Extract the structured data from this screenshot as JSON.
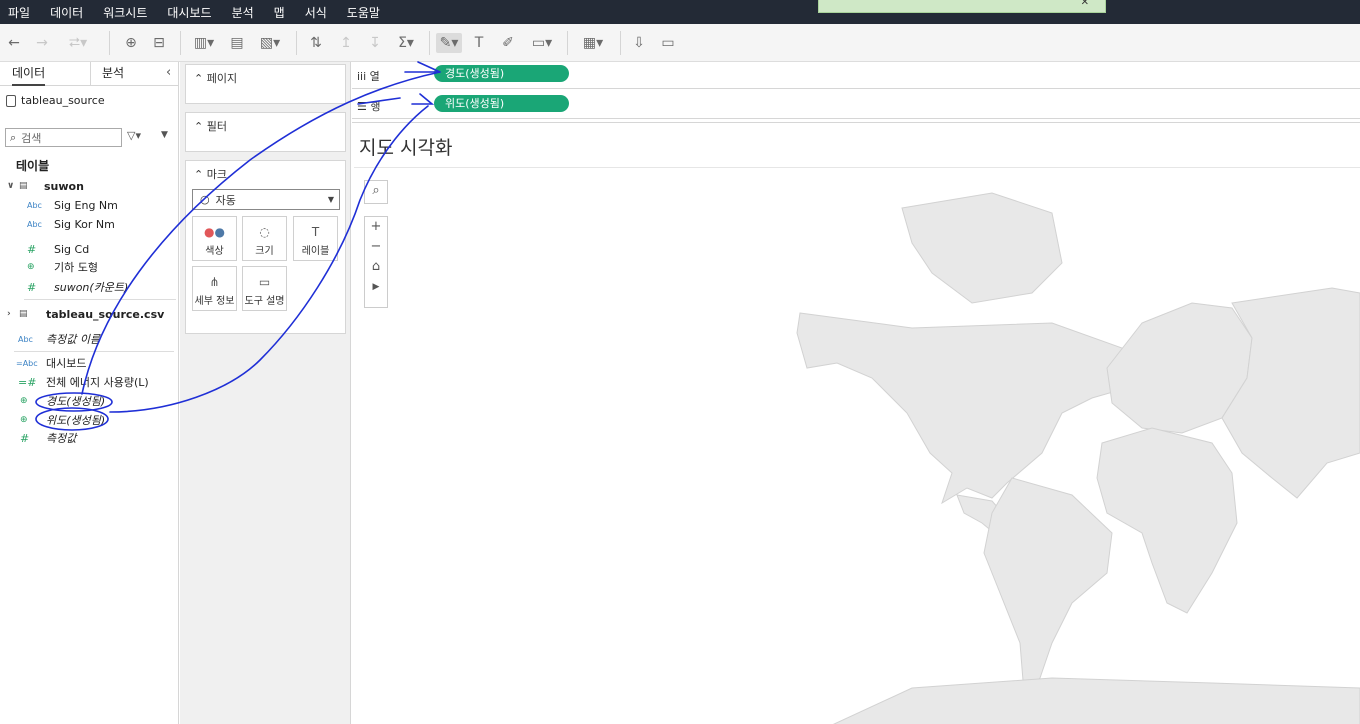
{
  "menu": [
    "파일",
    "데이터",
    "워크시트",
    "대시보드",
    "분석",
    "맵",
    "서식",
    "도움말"
  ],
  "data_pane": {
    "tab_data": "데이터",
    "tab_analysis": "분석",
    "datasource": "tableau_source",
    "search_placeholder": "검색",
    "section_tables": "테이블",
    "table1": {
      "name": "suwon",
      "fields": [
        {
          "type": "Abc",
          "name": "Sig Eng Nm"
        },
        {
          "type": "Abc",
          "name": "Sig Kor Nm"
        },
        {
          "type": "#",
          "name": "Sig Cd"
        },
        {
          "type": "globe",
          "name": "기하 도형"
        },
        {
          "type": "#",
          "name": "suwon(카운트)"
        }
      ]
    },
    "table2": {
      "name": "tableau_source.csv"
    },
    "extra_fields": [
      {
        "type": "Abc",
        "name": "측정값 이름"
      },
      {
        "type": "=Abc",
        "name": "대시보드"
      },
      {
        "type": "=#",
        "name": "전체 에너지 사용량(L)"
      },
      {
        "type": "globe",
        "name": "경도(생성됨)"
      },
      {
        "type": "globe",
        "name": "위도(생성됨)"
      },
      {
        "type": "#",
        "name": "측정값"
      }
    ]
  },
  "cards": {
    "pages": "페이지",
    "filters": "필터",
    "marks": "마크",
    "mark_type": "자동",
    "buttons": [
      "색상",
      "크기",
      "레이블",
      "세부 정보",
      "도구 설명"
    ]
  },
  "shelves": {
    "columns_label": "열",
    "rows_label": "행",
    "columns_pill": "경도(생성됨)",
    "rows_pill": "위도(생성됨)"
  },
  "view": {
    "title": "지도 시각화"
  }
}
